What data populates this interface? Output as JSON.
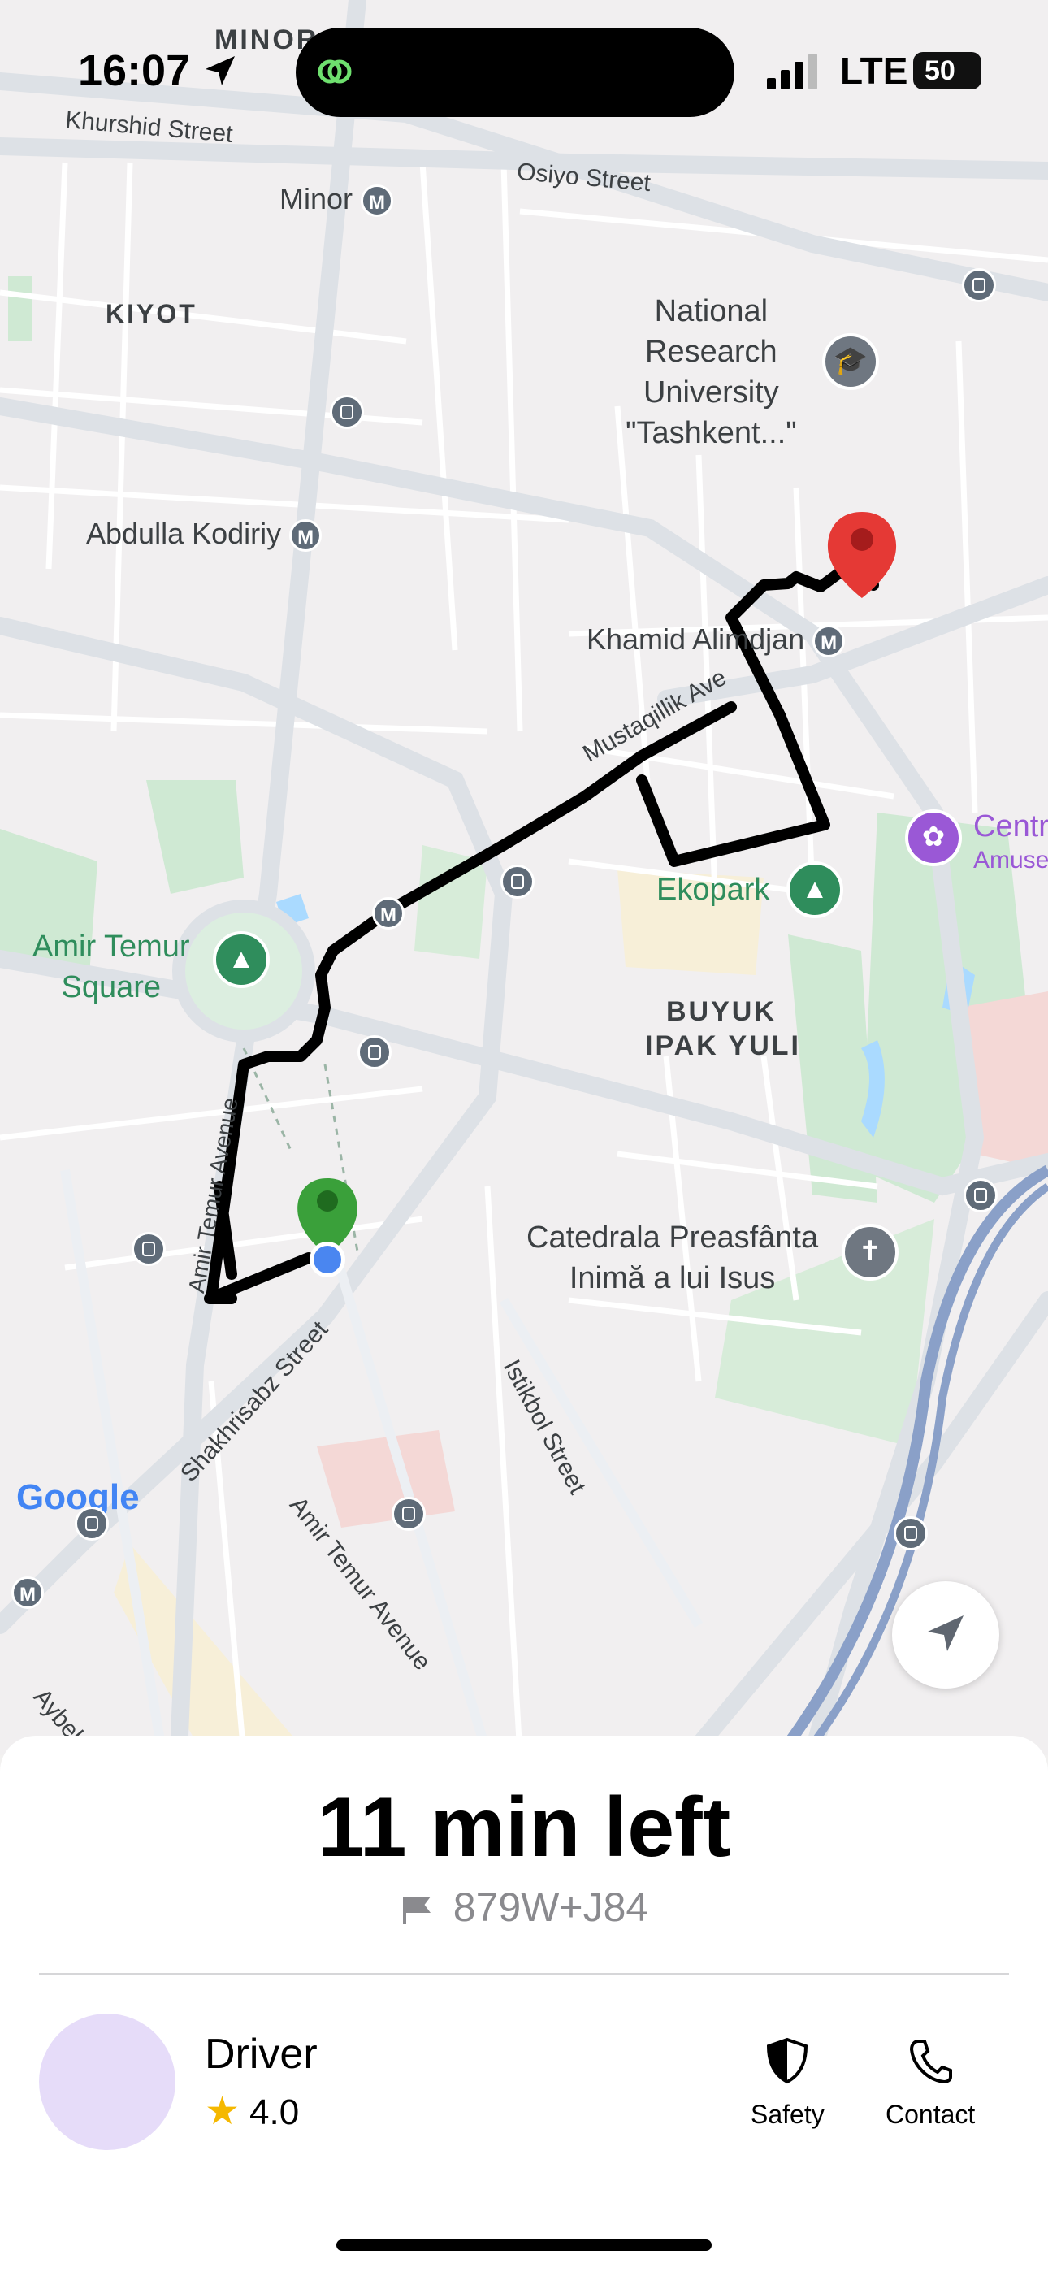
{
  "status_bar": {
    "time": "16:07",
    "network": "LTE",
    "battery": "50"
  },
  "map": {
    "labels": {
      "minor_top": "MINOR",
      "khurshid": "Khurshid Street",
      "osiyo": "Osiyo Street",
      "minor_station": "Minor",
      "kiyot": "KIYOT",
      "university": [
        "National",
        "Research",
        "University",
        "\"Tashkent...\""
      ],
      "abdulla": "Abdulla Kodiriy",
      "khamid": "Khamid Alimdjan",
      "mustaqillik": "Mustaqillik Ave",
      "center": "Centr",
      "amuse": "Amuse",
      "amir_square_1": "Amir Temur",
      "amir_square_2": "Square",
      "ekopark": "Ekopark",
      "buyuk_1": "BUYUK",
      "buyuk_2": "IPAK YULI",
      "amir_avenue_vertical": "Amir Temur Avenue",
      "cathedral_1": "Catedrala Preasfânta",
      "cathedral_2": "Inimă a lui Isus",
      "shakhrisabz": "Shakhrisabz Street",
      "istikbol": "Istikbol Street",
      "amir_avenue_diag": "Amir Temur Avenue",
      "aybek": "Aybek",
      "metro_letter": "M",
      "google": "Google"
    },
    "icons": {
      "origin": "green-pin-icon",
      "destination": "red-pin-icon",
      "current": "blue-dot-icon",
      "locate": "navigation-arrow-icon"
    },
    "colors": {
      "route": "#000000",
      "origin_pin": "#3aa03a",
      "destination_pin": "#e53935",
      "current_dot": "#4a86f0"
    }
  },
  "trip": {
    "eta": "11 min left",
    "destination_code": "879W+J84"
  },
  "driver": {
    "name": "Driver",
    "rating": "4.0"
  },
  "actions": {
    "safety": "Safety",
    "contact": "Contact"
  }
}
